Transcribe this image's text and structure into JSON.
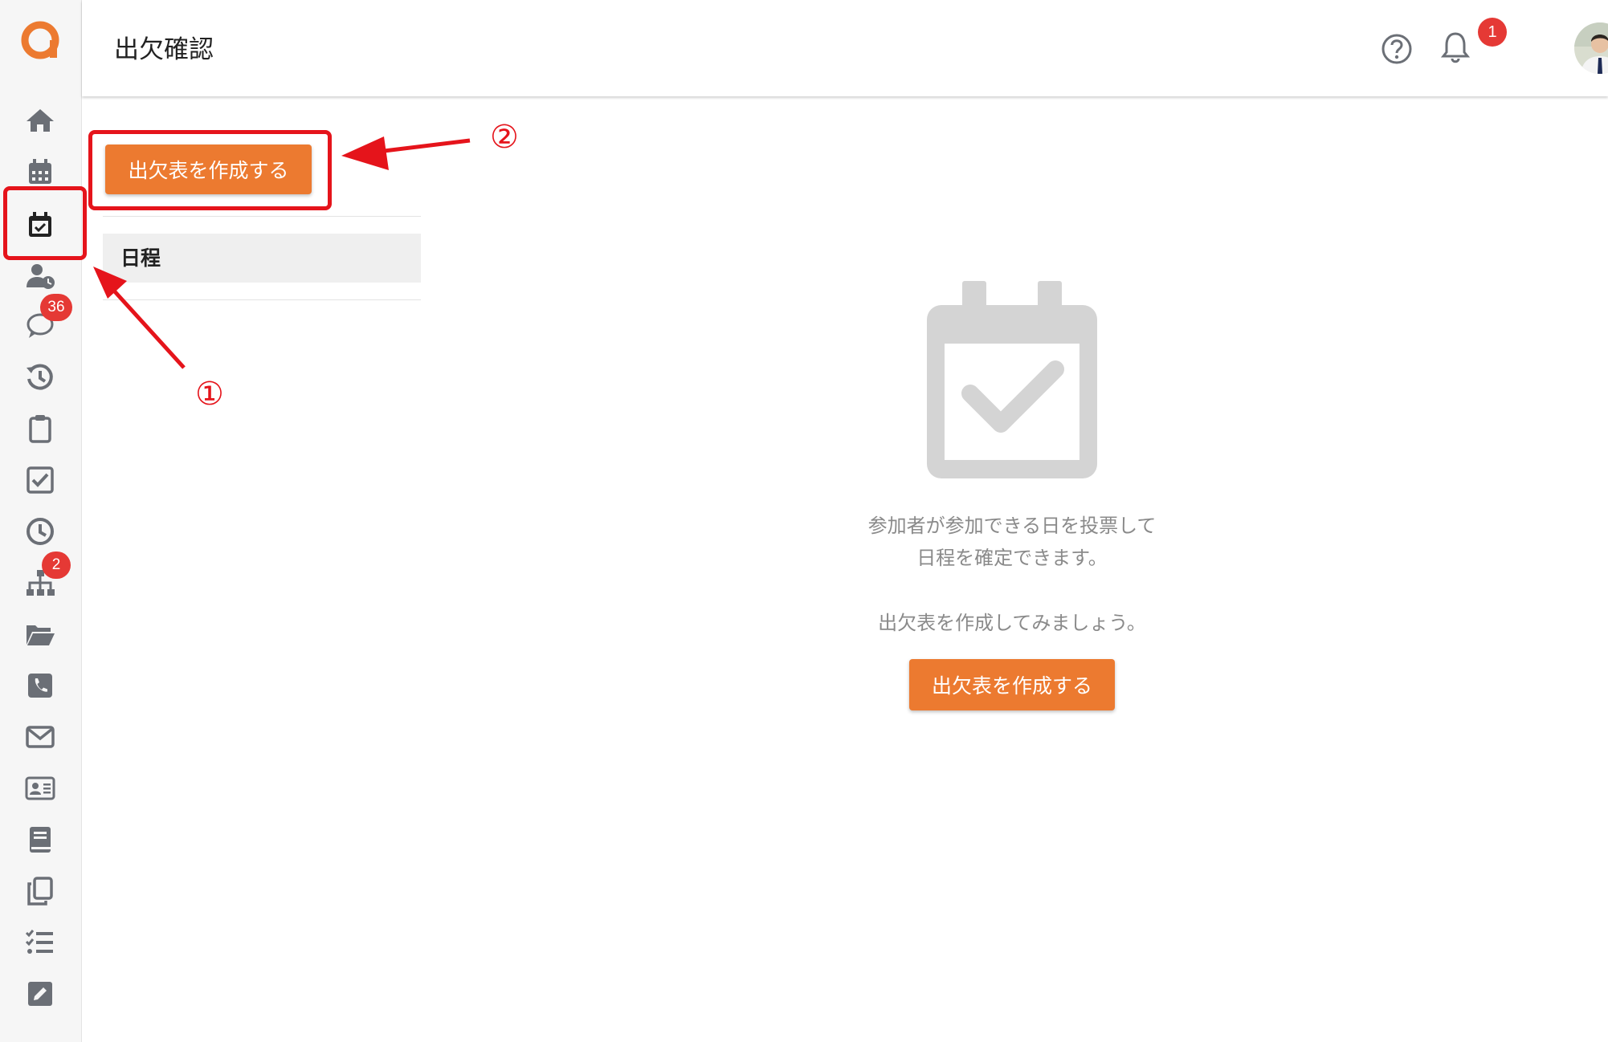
{
  "header": {
    "title": "出欠確認",
    "help_badge": "1"
  },
  "sidebar": {
    "items": [
      {
        "name": "home-icon"
      },
      {
        "name": "calendar-icon"
      },
      {
        "name": "attendance-calendar-check-icon",
        "active": true
      },
      {
        "name": "user-clock-icon"
      },
      {
        "name": "chat-bubble-icon",
        "badge": "36"
      },
      {
        "name": "history-icon"
      },
      {
        "name": "clipboard-icon"
      },
      {
        "name": "checkbox-icon"
      },
      {
        "name": "clock-icon"
      },
      {
        "name": "org-chart-icon",
        "badge": "2"
      },
      {
        "name": "folder-open-icon"
      },
      {
        "name": "phone-icon"
      },
      {
        "name": "mail-icon"
      },
      {
        "name": "contact-card-icon"
      },
      {
        "name": "book-icon"
      },
      {
        "name": "copy-icon"
      },
      {
        "name": "task-list-icon"
      },
      {
        "name": "edit-icon"
      }
    ],
    "badges": {
      "chat": "36",
      "org": "2"
    }
  },
  "left_panel": {
    "create_button": "出欠表を作成する",
    "list_header": "日程"
  },
  "empty_state": {
    "line1": "参加者が参加できる日を投票して",
    "line2": "日程を確定できます。",
    "line3": "出欠表を作成してみましょう。",
    "button": "出欠表を作成する"
  },
  "annotations": {
    "step1": "①",
    "step2": "②"
  },
  "colors": {
    "accent": "#ec7a30",
    "badge": "#e53935",
    "annotation": "#e5141b",
    "icon": "#6b6f76"
  }
}
